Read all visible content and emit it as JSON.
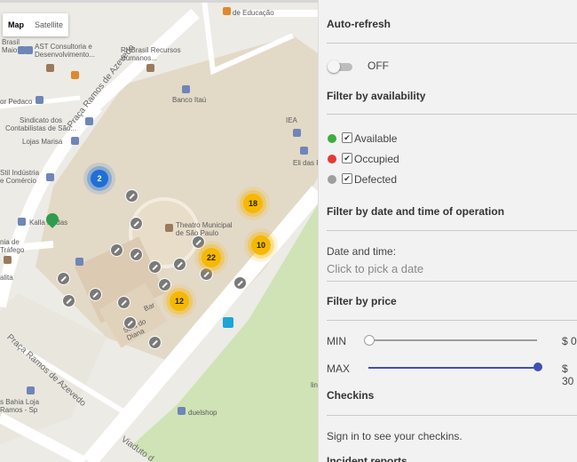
{
  "map": {
    "type_buttons": [
      "Map",
      "Satellite"
    ],
    "labels": {
      "ast": "AST Consultoria e\nDesenvolvimento...",
      "rhbrasil": "RHBrasil Recursos\nHumanos...",
      "educacao": "de Educação",
      "maio": "Brasil\nMaio",
      "pedaco": "or Pedaco",
      "sindicato": "Sindicato dos\nContabilistas de São...",
      "marisa": "Lojas Marisa",
      "banco_itau": "Banco Itaú",
      "iea": "IEA",
      "eli": "Eli das F",
      "stil": "Stil Indústria\ne Comércio",
      "kalla": "Kalla Rodas",
      "teatro": "Theatro Municipal\nde São Paulo",
      "nia": "nia de\nTráfego",
      "alita": "alita",
      "bar": "Bar",
      "sala": "Sala do\nDiana",
      "duelshop": "duelshop",
      "bahia": "s Bahia Loja\nRamos - Sp",
      "lin": "lin"
    },
    "streets": {
      "azevedo_top": "Praça Ramos de Azevedo",
      "azevedo_bottom": "Praça Ramos de Azevedo",
      "viaduto": "Viaduto d"
    },
    "clusters": [
      {
        "label": "2",
        "color": "blue"
      },
      {
        "label": "18",
        "color": "yellow"
      },
      {
        "label": "10",
        "color": "yellow"
      },
      {
        "label": "22",
        "color": "yellow"
      },
      {
        "label": "12",
        "color": "yellow"
      }
    ]
  },
  "panel": {
    "auto_refresh": {
      "title": "Auto-refresh",
      "toggle_state": "OFF"
    },
    "availability": {
      "title": "Filter by availability",
      "items": [
        {
          "label": "Available",
          "color": "#3cae3f",
          "checked": true
        },
        {
          "label": "Occupied",
          "color": "#e53935",
          "checked": true
        },
        {
          "label": "Defected",
          "color": "#9e9e9e",
          "checked": true
        }
      ]
    },
    "date_time": {
      "title": "Filter by date and time of operation",
      "field_label": "Date and time:",
      "placeholder": "Click to pick a date"
    },
    "price": {
      "title": "Filter by price",
      "min_label": "MIN",
      "min_value": "$ 0",
      "max_label": "MAX",
      "max_value": "$ 30",
      "accent": "#3f51b5"
    },
    "checkins": {
      "title": "Checkins",
      "message": "Sign in to see your checkins."
    },
    "incidents": {
      "title": "Incident reports"
    }
  }
}
